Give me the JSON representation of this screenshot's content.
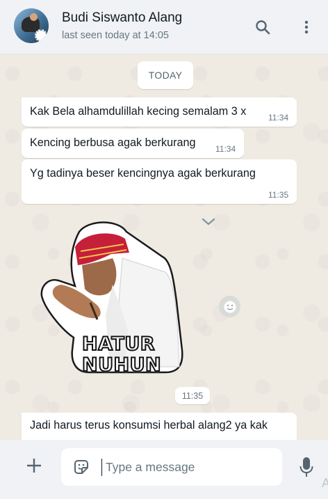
{
  "header": {
    "contact_name": "Budi Siswanto Alang",
    "last_seen": "last seen today at 14:05"
  },
  "chat": {
    "date_divider": "TODAY",
    "messages": [
      {
        "text": "Kak Bela alhamdulillah kecing semalam 3 x",
        "time": "11:34"
      },
      {
        "text": "Kencing berbusa agak berkurang",
        "time": "11:34"
      },
      {
        "text": "Yg tadinya beser kencingnya agak berkurang",
        "time": "11:35"
      }
    ],
    "sticker": {
      "caption_line1": "HATUR",
      "caption_line2": "NUHUN",
      "time": "11:35"
    },
    "last_message": {
      "text": "Jadi harus terus konsumsi herbal alang2 ya kak"
    }
  },
  "composer": {
    "placeholder": "Type a message",
    "edge_glyph": "A"
  },
  "icons": [
    "search-icon",
    "menu-icon",
    "chevron-down-icon",
    "emoji-icon",
    "plus-icon",
    "sticker-icon",
    "mic-icon"
  ],
  "colors": {
    "chat_bg": "#efeae2",
    "bubble": "#ffffff",
    "header": "#f0f2f5",
    "icon": "#54656f"
  }
}
